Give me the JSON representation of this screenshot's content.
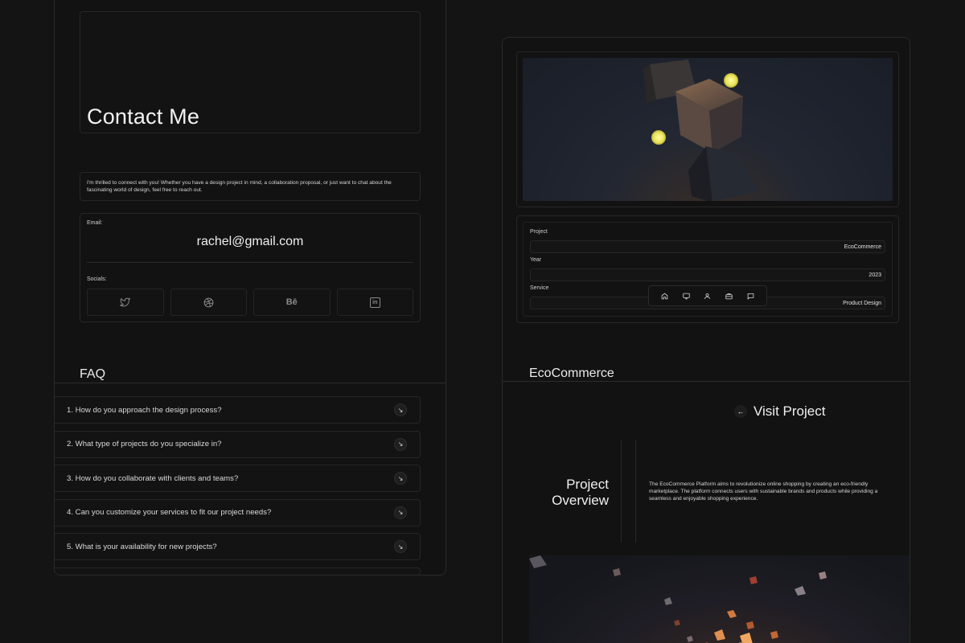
{
  "contact": {
    "title": "Contact Me",
    "intro": "I'm thrilled to connect with you! Whether you have a design project in mind, a collaboration proposal, or just want to chat about the fascinating world of design, feel free to reach out.",
    "email_label": "Email:",
    "email": "rachel@gmail.com",
    "socials_label": "Socials:",
    "socials": [
      {
        "name": "twitter-icon",
        "glyph": ""
      },
      {
        "name": "dribbble-icon",
        "glyph": ""
      },
      {
        "name": "behance-icon",
        "glyph": "Bē"
      },
      {
        "name": "linkedin-icon",
        "glyph": "in"
      }
    ]
  },
  "faq": {
    "title": "FAQ",
    "items": [
      "1. How do you approach the design process?",
      "2. What type of projects do you specialize in?",
      "3. How do you collaborate with clients and teams?",
      "4. Can you customize your services to fit our project needs?",
      "5. What is your availability for new projects?"
    ]
  },
  "project": {
    "project_label": "Project",
    "project_value": "EcoCommerce",
    "year_label": "Year",
    "year_value": "2023",
    "service_label": "Service",
    "service_value": "Product Design",
    "name": "EcoCommerce",
    "visit_label": "Visit Project",
    "overview_title": "Project Overview",
    "overview_text": "The EcoCommerce Platform aims to revolutionize online shopping by creating an eco-friendly marketplace. The platform connects users with sustainable brands and products while providing a seamless and enjoyable shopping experience."
  },
  "nav": [
    "home-icon",
    "monitor-icon",
    "user-icon",
    "briefcase-icon",
    "chat-icon"
  ],
  "colors": {
    "background": "#141414",
    "panel": "#121212",
    "accent_glow": "#f0ec6a"
  }
}
